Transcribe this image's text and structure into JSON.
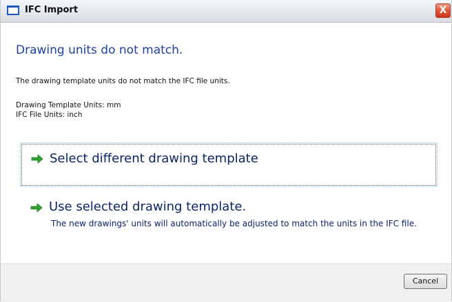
{
  "window": {
    "title": "IFC Import",
    "close_label": "X"
  },
  "content": {
    "heading": "Drawing units do not match.",
    "message": "The drawing template units do not match the IFC file units.",
    "template_units": "Drawing Template Units: mm",
    "ifc_units": "IFC File Units: inch"
  },
  "options": [
    {
      "label": "Select different drawing template",
      "description": "",
      "icon": "green-arrow-right-icon",
      "selected": true
    },
    {
      "label": "Use selected drawing template.",
      "description": "The new drawings' units will automatically be adjusted to match the units in the IFC file.",
      "icon": "green-arrow-right-icon",
      "selected": false
    }
  ],
  "footer": {
    "cancel_label": "Cancel"
  },
  "colors": {
    "heading": "#1c3fa1",
    "option_text": "#0a2468",
    "arrow": "#2fa32f",
    "close": "#e0583c"
  }
}
